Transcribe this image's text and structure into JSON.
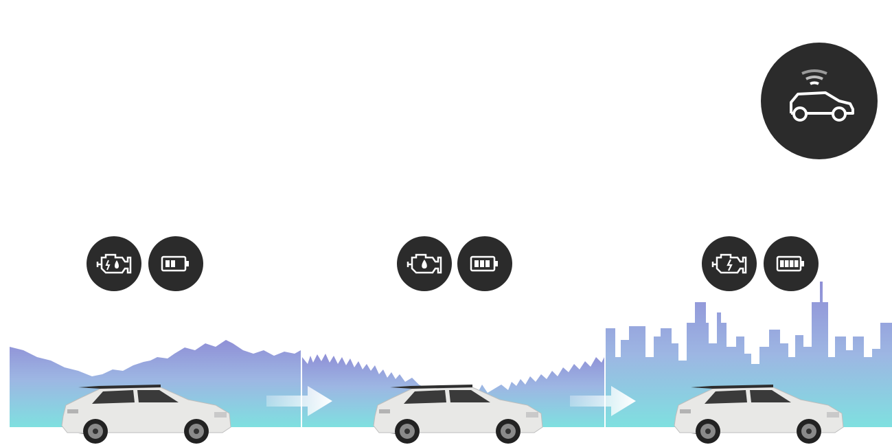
{
  "scenes": [
    {
      "name": "mountains",
      "engine_icon": "hybrid-engine-icon",
      "battery_icon": "battery-two-bars-icon",
      "battery_level": 0.5
    },
    {
      "name": "forest-town",
      "engine_icon": "fuel-engine-icon",
      "battery_icon": "battery-three-bars-icon",
      "battery_level": 0.75
    },
    {
      "name": "city",
      "engine_icon": "electric-engine-icon",
      "battery_icon": "battery-full-icon",
      "battery_level": 1.0
    }
  ],
  "badge_icon": "connected-car-icon",
  "colors": {
    "icon_bg": "#2b2b2b",
    "sky_top": "#8f8fd6",
    "sky_bottom": "#7fe0e0",
    "arrow": "#ffffff",
    "car_body": "#e8e8e6"
  }
}
